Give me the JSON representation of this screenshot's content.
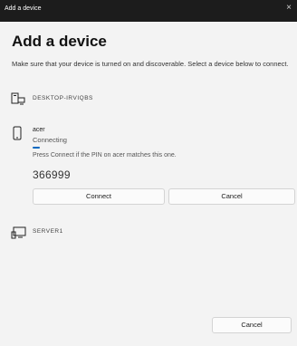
{
  "window": {
    "title": "Add a device",
    "close_glyph": "×"
  },
  "heading": "Add a device",
  "description": "Make sure that your device is turned on and discoverable. Select a device below to connect.",
  "devices": [
    {
      "icon": "computer-icon",
      "name": "DESKTOP-IRVIQBS"
    },
    {
      "icon": "phone-icon",
      "name": "acer",
      "status": "Connecting",
      "progress": 0.05,
      "pin_message": "Press Connect if the PIN on acer matches this one.",
      "pin": "366999",
      "connect_label": "Connect",
      "cancel_label": "Cancel"
    },
    {
      "icon": "display-icon",
      "name": "SERVER1"
    }
  ],
  "footer": {
    "cancel_label": "Cancel"
  },
  "colors": {
    "accent": "#0067c0",
    "titlebar": "#1c1c1c",
    "background": "#f3f3f3"
  }
}
